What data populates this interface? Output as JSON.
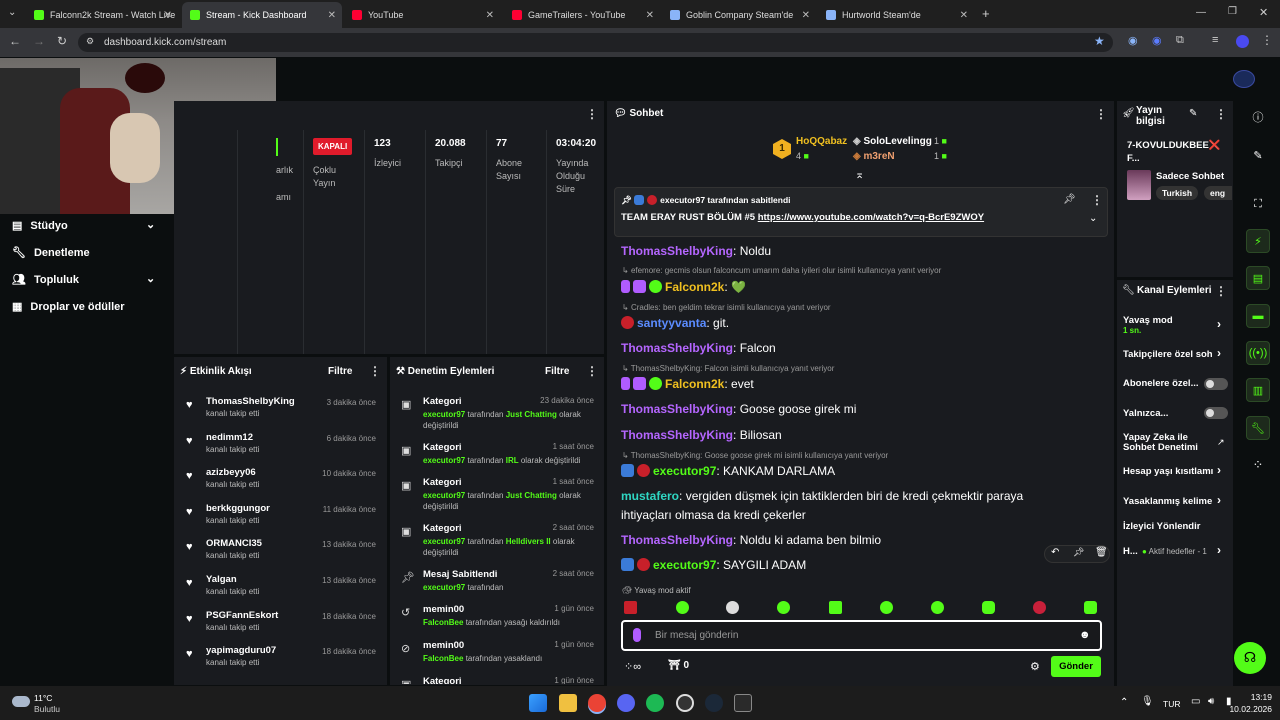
{
  "browser": {
    "tabs": [
      {
        "title": "Falconn2k Stream - Watch Live",
        "color": "#53fc18"
      },
      {
        "title": "Stream - Kick Dashboard",
        "color": "#53fc18"
      },
      {
        "title": "YouTube",
        "color": "#ff0033"
      },
      {
        "title": "GameTrailers - YouTube",
        "color": "#ff0033"
      },
      {
        "title": "Goblin Company Steam'de",
        "color": "#1b2838"
      },
      {
        "title": "Hurtworld Steam'de",
        "color": "#1b2838"
      }
    ],
    "url": "dashboard.kick.com/stream"
  },
  "sidebar": {
    "items": [
      {
        "label": "Stüdyo",
        "icon": "studio-icon"
      },
      {
        "label": "Denetleme",
        "icon": "wrench-icon"
      },
      {
        "label": "Topluluk",
        "icon": "users-icon"
      },
      {
        "label": "Droplar ve ödüller",
        "icon": "gift-icon"
      }
    ]
  },
  "stream_info": {
    "partial_labels": [
      "arlık",
      "amı"
    ],
    "status_badge": "KAPALI",
    "multi_stream": "Çoklu Yayın",
    "stats": [
      {
        "value": "123",
        "label": "İzleyici"
      },
      {
        "value": "20.088",
        "label": "Takipçi"
      },
      {
        "value": "77",
        "label": "Abone Sayısı"
      },
      {
        "value": "03:04:20",
        "label": "Yayında Olduğu Süre"
      }
    ]
  },
  "activity": {
    "title": "Etkinlik Akışı",
    "filter": "Filtre",
    "items": [
      {
        "name": "ThomasShelbyKing",
        "sub": "kanalı takip etti",
        "time": "3 dakika önce"
      },
      {
        "name": "nedimm12",
        "sub": "kanalı takip etti",
        "time": "6 dakika önce"
      },
      {
        "name": "azizbeyy06",
        "sub": "kanalı takip etti",
        "time": "10 dakika önce"
      },
      {
        "name": "berkkggungor",
        "sub": "kanalı takip etti",
        "time": "11 dakika önce"
      },
      {
        "name": "ORMANCI35",
        "sub": "kanalı takip etti",
        "time": "13 dakika önce"
      },
      {
        "name": "Yalgan",
        "sub": "kanalı takip etti",
        "time": "13 dakika önce"
      },
      {
        "name": "PSGFannEskort",
        "sub": "kanalı takip etti",
        "time": "18 dakika önce"
      },
      {
        "name": "yapimagduru07",
        "sub": "kanalı takip etti",
        "time": "18 dakika önce"
      }
    ]
  },
  "moderation": {
    "title": "Denetim Eylemleri",
    "filter": "Filtre",
    "items": [
      {
        "name": "Kategori",
        "time": "23 dakika önce",
        "actor": "executor97",
        "pre": " tarafından ",
        "hl": "Just Chatting",
        "post": " olarak değiştirildi"
      },
      {
        "name": "Kategori",
        "time": "1 saat önce",
        "actor": "executor97",
        "pre": " tarafından ",
        "hl": "IRL",
        "post": " olarak değiştirildi"
      },
      {
        "name": "Kategori",
        "time": "1 saat önce",
        "actor": "executor97",
        "pre": " tarafından ",
        "hl": "Just Chatting",
        "post": " olarak değiştirildi"
      },
      {
        "name": "Kategori",
        "time": "2 saat önce",
        "actor": "executor97",
        "pre": " tarafından ",
        "hl": "Helldivers II",
        "post": " olarak değiştirildi"
      },
      {
        "name": "Mesaj Sabitlendi",
        "time": "2 saat önce",
        "actor": "executor97",
        "pre": " tarafından",
        "hl": "",
        "post": ""
      },
      {
        "name": "memin00",
        "time": "1 gün önce",
        "actor": "FalconBee",
        "pre": " tarafından yasağı kaldırıldı",
        "hl": "",
        "post": ""
      },
      {
        "name": "memin00",
        "time": "1 gün önce",
        "actor": "FalconBee",
        "pre": " tarafından yasaklandı",
        "hl": "",
        "post": ""
      },
      {
        "name": "Kategori",
        "time": "1 gün önce",
        "actor": "",
        "pre": "",
        "hl": "",
        "post": ""
      }
    ]
  },
  "chat": {
    "title": "Sohbet",
    "leaderboard": {
      "rank": "1",
      "top_name": "HoQQabaz",
      "top_count": "4",
      "users": [
        {
          "name": "SoloLevelingg",
          "count": "1"
        },
        {
          "name": "m3reN",
          "count": "1"
        }
      ]
    },
    "pinned_by": "executor97",
    "pinned_by_suffix": " tarafından sabitlendi",
    "pinned_text": "TEAM ERAY RUST BÖLÜM #5 ",
    "pinned_link": "https://www.youtube.com/watch?v=q-BcrE9ZWOY",
    "messages": [
      {
        "reply": "",
        "user": "ThomasShelbyKing",
        "color": "#b566ff",
        "text": "Noldu"
      },
      {
        "reply": "efemore: gecmis olsun falconcum umarım daha iyileri olur isimli kullanıcıya yanıt veriyor",
        "user": "Falconn2k",
        "color": "#f0c020",
        "text": "💚"
      },
      {
        "reply": "Cradles: ben geldim tekrar isimli kullanıcıya yanıt veriyor",
        "user": "santyyvanta",
        "color": "#5b8cff",
        "text": "git."
      },
      {
        "reply": "",
        "user": "ThomasShelbyKing",
        "color": "#b566ff",
        "text": "Falcon"
      },
      {
        "reply": "ThomasShelbyKing: Falcon isimli kullanıcıya yanıt veriyor",
        "user": "Falconn2k",
        "color": "#f0c020",
        "text": "evet"
      },
      {
        "reply": "",
        "user": "ThomasShelbyKing",
        "color": "#b566ff",
        "text": "Goose goose girek mi"
      },
      {
        "reply": "",
        "user": "ThomasShelbyKing",
        "color": "#b566ff",
        "text": "Biliosan"
      },
      {
        "reply": "ThomasShelbyKing: Goose goose girek mi isimli kullanıcıya yanıt veriyor",
        "user": "executor97",
        "color": "#53fc18",
        "text": "KANKAM DARLAMA"
      },
      {
        "reply": "",
        "user": "mustafero",
        "color": "#2fd6c2",
        "text": "vergiden düşmek için taktiklerden biri de kredi çekmektir paraya",
        "text2": "ihtiyaçları olmasa da kredi çekerler"
      },
      {
        "reply": "",
        "user": "ThomasShelbyKing",
        "color": "#b566ff",
        "text": "Noldu ki adama ben bilmio"
      },
      {
        "reply": "",
        "user": "executor97",
        "color": "#53fc18",
        "text": "SAYGILI ADAM"
      }
    ],
    "slow_mode_notice": "Yavaş mod aktif",
    "input_placeholder": "Bir mesaj gönderin",
    "points": "0",
    "send_label": "Gönder"
  },
  "stream_panel": {
    "title": "Yayın bilgisi",
    "stream_title": "7-KOVULDUKBEE❌F...",
    "category": "Sadece Sohbet",
    "tags": [
      "Turkish",
      "eng"
    ]
  },
  "channel_actions": {
    "title": "Kanal Eylemleri",
    "slow_mode": "Yavaş mod",
    "slow_mode_value": "1 sn.",
    "followers_only": "Takipçilere özel soh",
    "subs_only": "Abonelere özel...",
    "only": "Yalnızca...",
    "ai_mod": "Yapay Zeka ile Sohbet Denetimi",
    "account_age": "Hesap yaşı kısıtlamı",
    "banned_words": "Yasaklanmış kelime",
    "redirect": "İzleyici Yönlendir",
    "goals_prefix": "H...",
    "goals": "Aktif hedefler - 1"
  },
  "taskbar": {
    "weather_temp": "11°C",
    "weather_desc": "Bulutlu",
    "lang": "TUR",
    "time": "13:19",
    "date": "10.02.2026"
  }
}
